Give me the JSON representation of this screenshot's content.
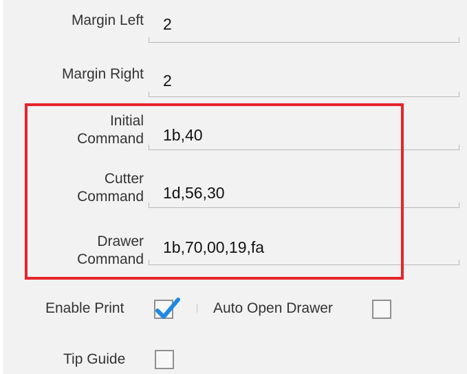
{
  "fields": [
    {
      "label_lines": [
        "Margin Left"
      ],
      "value": "2"
    },
    {
      "label_lines": [
        "Margin Right"
      ],
      "value": "2"
    },
    {
      "label_lines": [
        "Initial",
        "Command"
      ],
      "value": "1b,40"
    },
    {
      "label_lines": [
        "Cutter",
        "Command"
      ],
      "value": "1d,56,30"
    },
    {
      "label_lines": [
        "Drawer",
        "Command"
      ],
      "value": "1b,70,00,19,fa"
    }
  ],
  "enable_print": {
    "label": "Enable Print",
    "checked": true
  },
  "auto_open_drawer": {
    "label": "Auto Open Drawer",
    "checked": false
  },
  "tip_guide": {
    "label": "Tip Guide",
    "checked": false
  },
  "colors": {
    "highlight_border": "#e8232a",
    "checkmark": "#1e88e5"
  },
  "icons": {
    "checkmark": "checkmark-icon"
  }
}
